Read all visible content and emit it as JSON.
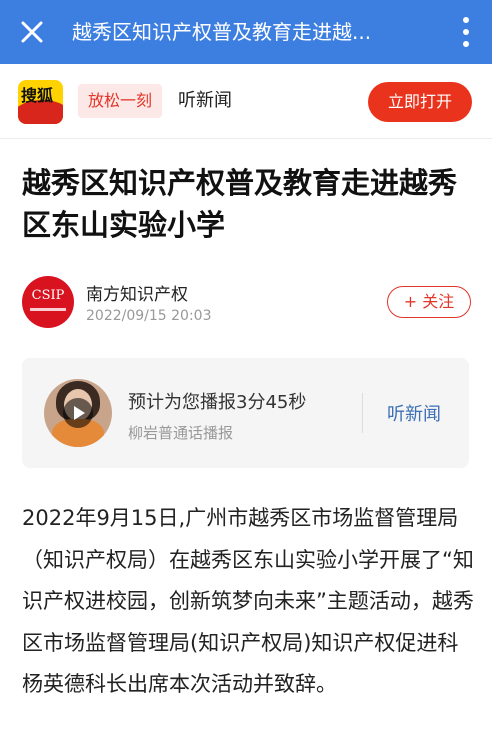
{
  "topbar": {
    "title": "越秀区知识产权普及教育走进越...",
    "close_icon": "close-icon",
    "more_icon": "more-vertical-icon",
    "background": "#3d7fe0"
  },
  "appbar": {
    "logo_text": "搜狐",
    "tag": "放松一刻",
    "listen_label": "听新闻",
    "open_button": "立即打开",
    "accent": "#e9331d"
  },
  "article": {
    "headline": "越秀区知识产权普及教育走进越秀区东山实验小学",
    "author": {
      "avatar_text": "CSIP",
      "name": "南方知识产权",
      "time": "2022/09/15 20:03",
      "follow_label": "+ 关注"
    },
    "audio": {
      "title": "预计为您播报3分45秒",
      "voice": "柳岩普通话播报",
      "listen_label": "听新闻",
      "play_icon": "play-icon"
    },
    "body": "2022年9月15日,广州市越秀区市场监督管理局（知识产权局）在越秀区东山实验小学开展了“知识产权进校园，创新筑梦向未来”主题活动，越秀区市场监督管理局(知识产权局)知识产权促进科杨英德科长出席本次活动并致辞。"
  }
}
